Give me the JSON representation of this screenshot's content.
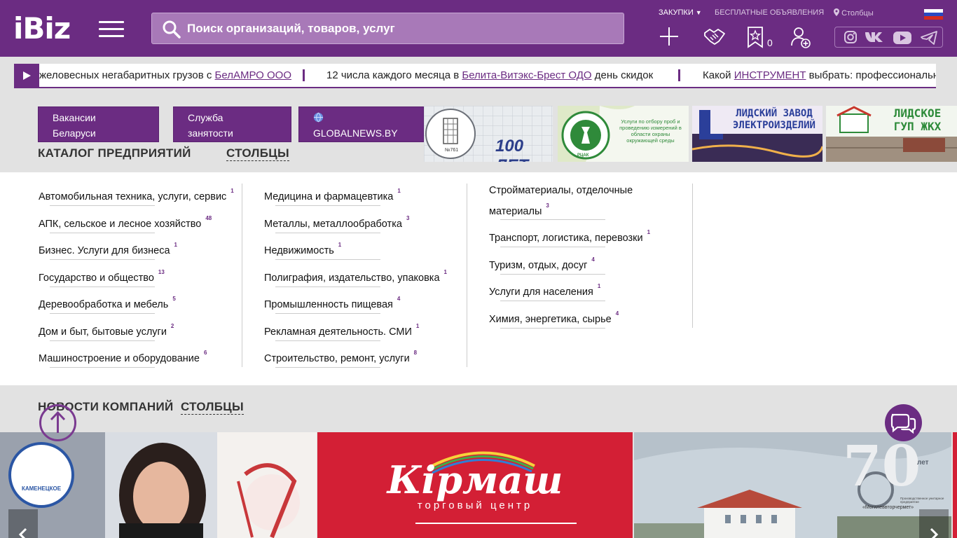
{
  "header": {
    "logo": "iBiz",
    "search_placeholder": "Поиск организаций, товаров, услуг",
    "links": {
      "purchases": "ЗАКУПКИ",
      "free_ads": "БЕСПЛАТНЫЕ ОБЪЯВЛЕНИЯ",
      "city": "Столбцы"
    },
    "favorites_count": "0",
    "icons": [
      "plus-icon",
      "handshake-icon",
      "star-icon",
      "user-add-icon",
      "instagram-icon",
      "vk-icon",
      "youtube-icon",
      "telegram-icon"
    ]
  },
  "ticker": [
    {
      "pre": "желовесных негабаритных грузов с ",
      "link": "БелАМРО ООО",
      "post": ""
    },
    {
      "pre": "12 числа каждого месяца в ",
      "link": "Белита-Витэкс-Брест ОДО",
      "post": " день скидок"
    },
    {
      "pre": "Какой ",
      "link": "ИНСТРУМЕНТ",
      "post": " выбрать: профессиональны"
    }
  ],
  "promo_buttons": [
    {
      "line1": "Вакансии",
      "line2": "Беларуси"
    },
    {
      "line1": "Служба",
      "line2": "занятости"
    },
    {
      "line1": "",
      "line2": "GLOBALNEWS.BY"
    }
  ],
  "ads": [
    {
      "text": "100 ЛЕТ",
      "sub": "№761"
    },
    {
      "text": "Услуги по отбору проб и проведению измерений в области охраны окружающей среды",
      "sub": "РЦАК"
    },
    {
      "text": "ЛИДСКИЙ ЗАВОД ЭЛЕКТРОИЗДЕЛИЙ",
      "sub": ""
    },
    {
      "text": "ЛИДСКОЕ ГУП ЖКХ",
      "sub": ""
    }
  ],
  "catalog": {
    "title": "КАТАЛОГ ПРЕДПРИЯТИЙ",
    "city": "СТОЛБЦЫ",
    "columns": [
      [
        {
          "name": "Автомобильная техника, услуги, сервис",
          "count": "1"
        },
        {
          "name": "АПК, сельское и лесное хозяйство",
          "count": "48"
        },
        {
          "name": "Бизнес. Услуги для бизнеса",
          "count": "1"
        },
        {
          "name": "Государство и общество",
          "count": "13"
        },
        {
          "name": "Деревообработка и мебель",
          "count": "5"
        },
        {
          "name": "Дом и быт, бытовые услуги",
          "count": "2"
        },
        {
          "name": "Машиностроение и оборудование",
          "count": "6"
        }
      ],
      [
        {
          "name": "Медицина и фармацевтика",
          "count": "1"
        },
        {
          "name": "Металлы, металлообработка",
          "count": "3"
        },
        {
          "name": "Недвижимость",
          "count": "1"
        },
        {
          "name": "Полиграфия, издательство, упаковка",
          "count": "1"
        },
        {
          "name": "Промышленность пищевая",
          "count": "4"
        },
        {
          "name": "Рекламная деятельность. СМИ",
          "count": "1"
        },
        {
          "name": "Строительство, ремонт, услуги",
          "count": "8"
        }
      ],
      [
        {
          "name": "Стройматериалы, отделочные",
          "name2": "материалы",
          "count": "3"
        },
        {
          "name": "Транспорт, логистика, перевозки",
          "count": "1"
        },
        {
          "name": "Туризм, отдых, досуг",
          "count": "4"
        },
        {
          "name": "Услуги для населения",
          "count": "1"
        },
        {
          "name": "Химия, энергетика, сырье",
          "count": "4"
        }
      ]
    ]
  },
  "news": {
    "title": "НОВОСТИ КОМПАНИЙ",
    "city": "СТОЛБЦЫ",
    "cards": [
      {
        "logo": "КАМЕНЕЦКОЕ"
      },
      {
        "brand": "Кірмаш",
        "subtitle": "торговый центр"
      },
      {
        "years": "70",
        "years_label": "лет",
        "company": "«Могилеввторчермет»",
        "company_pre": "Производственное унитарное предприятие"
      }
    ]
  },
  "colors": {
    "brand": "#6b2c82",
    "search_bg": "#a879b8"
  }
}
